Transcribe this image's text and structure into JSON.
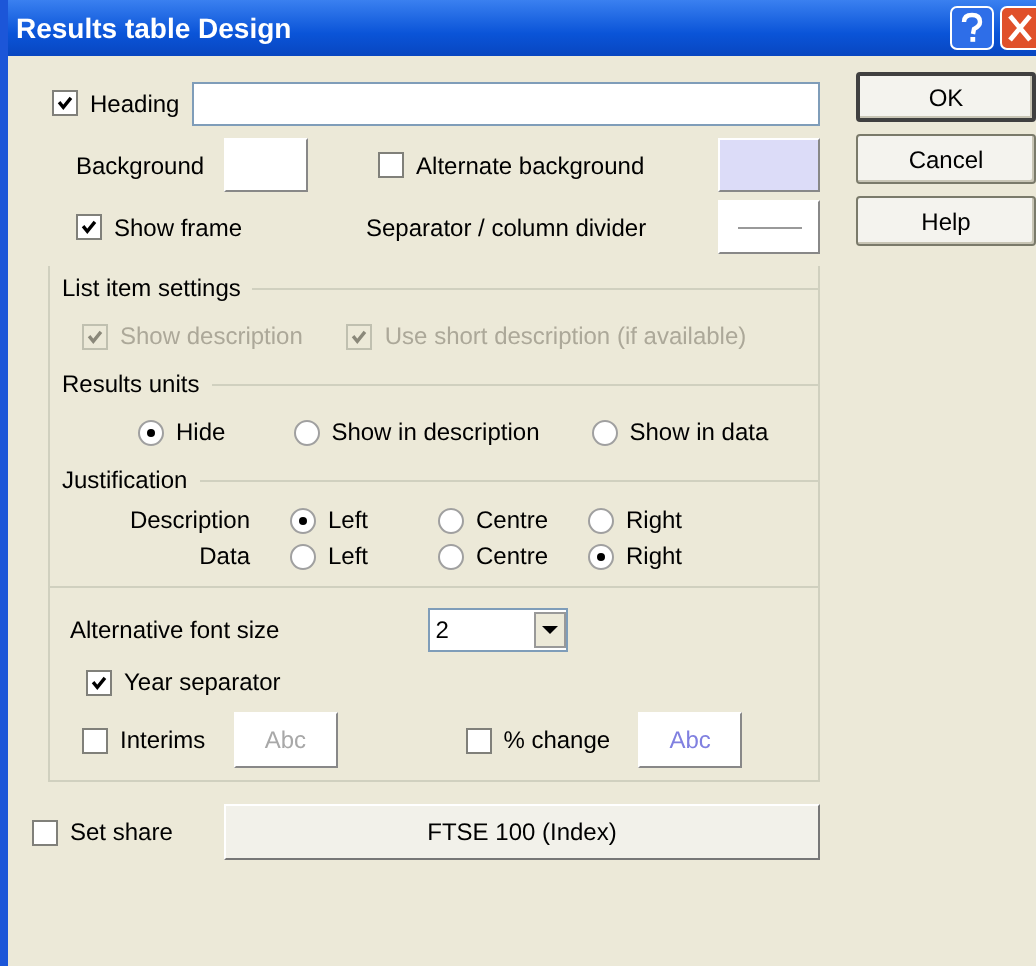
{
  "window": {
    "title": "Results table Design"
  },
  "heading": {
    "label": "Heading",
    "checked": true
  },
  "background": {
    "label": "Background",
    "color": "#ffffff"
  },
  "alternate_background": {
    "label": "Alternate background",
    "checked": false,
    "color": "#dcdcf8"
  },
  "show_frame": {
    "label": "Show frame",
    "checked": true
  },
  "separator": {
    "label": "Separator / column divider"
  },
  "list_item_settings": {
    "title": "List item settings",
    "options": [
      {
        "label": "Show description",
        "checked": true,
        "disabled": true
      },
      {
        "label": "Use short description (if available)",
        "checked": true,
        "disabled": true
      }
    ]
  },
  "results_units": {
    "title": "Results units",
    "options": [
      {
        "label": "Hide",
        "selected": true
      },
      {
        "label": "Show in description",
        "selected": false
      },
      {
        "label": "Show in data",
        "selected": false
      }
    ]
  },
  "justification": {
    "title": "Justification",
    "rows": [
      {
        "label": "Description",
        "options": [
          {
            "label": "Left",
            "selected": true
          },
          {
            "label": "Centre",
            "selected": false
          },
          {
            "label": "Right",
            "selected": false
          }
        ]
      },
      {
        "label": "Data",
        "options": [
          {
            "label": "Left",
            "selected": false
          },
          {
            "label": "Centre",
            "selected": false
          },
          {
            "label": "Right",
            "selected": true
          }
        ]
      }
    ]
  },
  "font_size": {
    "label": "Alternative font size",
    "value": "2"
  },
  "year_separator": {
    "label": "Year separator",
    "checked": true
  },
  "style_options": [
    {
      "label": "Interims",
      "checked": false,
      "sample": "Abc",
      "color": "#a8a8a8"
    },
    {
      "label": "% change",
      "checked": false,
      "sample": "Abc",
      "color": "#8080e0"
    }
  ],
  "set_share": {
    "label": "Set share",
    "checked": false,
    "button": "FTSE 100 (Index)"
  },
  "buttons": [
    {
      "label": "OK",
      "default": true
    },
    {
      "label": "Cancel",
      "default": false
    },
    {
      "label": "Help",
      "default": false
    }
  ]
}
